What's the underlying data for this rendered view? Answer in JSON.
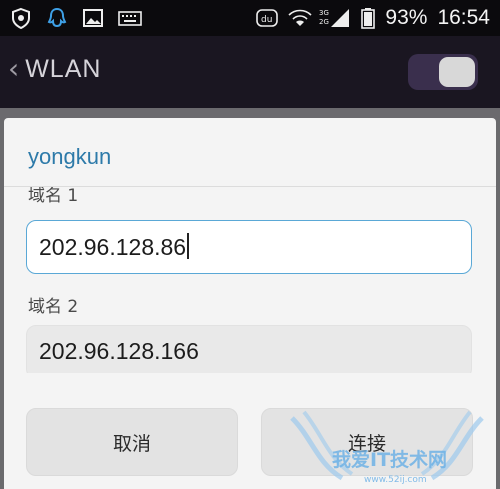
{
  "status_bar": {
    "battery_percent": "93%",
    "time": "16:54",
    "network_label_top": "3G",
    "network_label_bottom": "2G",
    "left_icons": [
      "shield-badge-icon",
      "penguin-icon",
      "image-icon",
      "keyboard-icon"
    ],
    "right_icons": [
      "du-badge-icon",
      "wifi-icon",
      "cellular-signal-icon",
      "battery-icon"
    ]
  },
  "app_bar": {
    "title": "WLAN",
    "toggle_on": true
  },
  "dialog": {
    "title": "yongkun",
    "field1": {
      "label": "域名 1",
      "value": "202.96.128.86"
    },
    "field2": {
      "label": "域名 2",
      "value": "202.96.128.166"
    },
    "buttons": {
      "cancel": "取消",
      "connect": "连接"
    }
  },
  "watermark": {
    "text": "我爱IT技术网",
    "url": "www.52ij.com"
  },
  "colors": {
    "accent": "#2d7aa9",
    "input_focus_border": "#5aa8d6",
    "app_bar_bg": "#1a1621"
  }
}
